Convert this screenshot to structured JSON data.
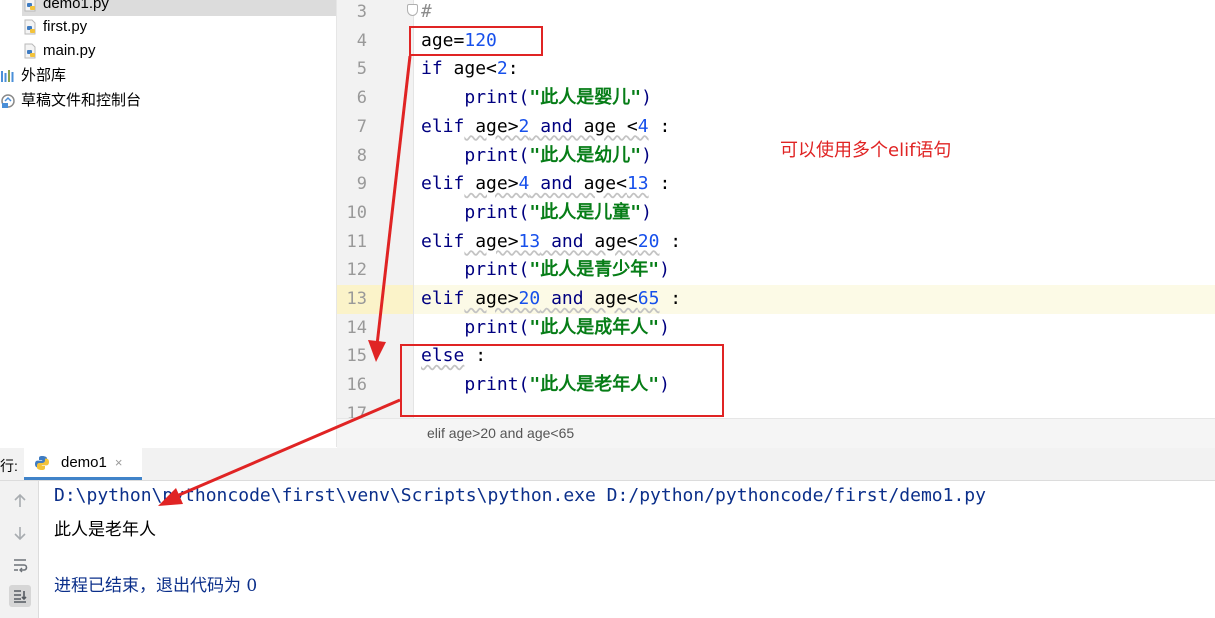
{
  "project_tree": [
    {
      "label": "demo1.py",
      "type": "python-file",
      "selected": true
    },
    {
      "label": "first.py",
      "type": "python-file",
      "selected": false
    },
    {
      "label": "main.py",
      "type": "python-file",
      "selected": false
    },
    {
      "label": "外部库",
      "type": "library",
      "selected": false
    },
    {
      "label": "草稿文件和控制台",
      "type": "scratch",
      "selected": false
    }
  ],
  "editor": {
    "line_numbers": [
      "3",
      "4",
      "5",
      "6",
      "7",
      "8",
      "9",
      "10",
      "11",
      "12",
      "13",
      "14",
      "15",
      "16",
      "17"
    ],
    "current_line": "13",
    "breadcrumb": "elif age>20 and age<65"
  },
  "code": {
    "l3": {
      "comment": "#"
    },
    "l4": {
      "var": "age",
      "op": "=",
      "num": "120"
    },
    "l5": {
      "kw": "if",
      "a": " age<",
      "num": "2",
      "b": ":"
    },
    "l6": {
      "indent": "    ",
      "fn": "print(",
      "str": "\"此人是婴儿\"",
      "end": ")"
    },
    "l7": {
      "kw": "elif",
      "a": " age>",
      "n1": "2",
      "and": " and ",
      "b": "age <",
      "n2": "4",
      "c": " :"
    },
    "l8": {
      "indent": "    ",
      "fn": "print(",
      "str": "\"此人是幼儿\"",
      "end": ")"
    },
    "l9": {
      "kw": "elif",
      "a": " age>",
      "n1": "4",
      "and": " and ",
      "b": "age<",
      "n2": "13",
      "c": " :"
    },
    "l10": {
      "indent": "    ",
      "fn": "print(",
      "str": "\"此人是儿童\"",
      "end": ")"
    },
    "l11": {
      "kw": "elif",
      "a": " age>",
      "n1": "13",
      "and": " and ",
      "b": "age<",
      "n2": "20",
      "c": " :"
    },
    "l12": {
      "indent": "    ",
      "fn": "print(",
      "str": "\"此人是青少年\"",
      "end": ")"
    },
    "l13": {
      "kw": "elif",
      "a": " age>",
      "n1": "20",
      "and": " and ",
      "b": "age<",
      "n2": "65",
      "c": " :"
    },
    "l14": {
      "indent": "    ",
      "fn": "print(",
      "str": "\"此人是成年人\"",
      "end": ")"
    },
    "l15": {
      "kw": "else",
      "c": " :"
    },
    "l16": {
      "indent": "    ",
      "fn": "print(",
      "str": "\"此人是老年人\"",
      "end": ")"
    }
  },
  "run_panel": {
    "label": "行:",
    "tab_name": "demo1",
    "close_glyph": "×",
    "command": "D:\\python\\pythoncode\\first\\venv\\Scripts\\python.exe D:/python/pythoncode/first/demo1.py",
    "output": "此人是老年人",
    "exit_message": "进程已结束，退出代码为 0"
  },
  "annotation_text": "可以使用多个elif语句",
  "colors": {
    "annotation_red": "#e02424",
    "keyword": "#000080",
    "number": "#1750eb",
    "string": "#067d17",
    "tab_underline": "#4083c9"
  }
}
